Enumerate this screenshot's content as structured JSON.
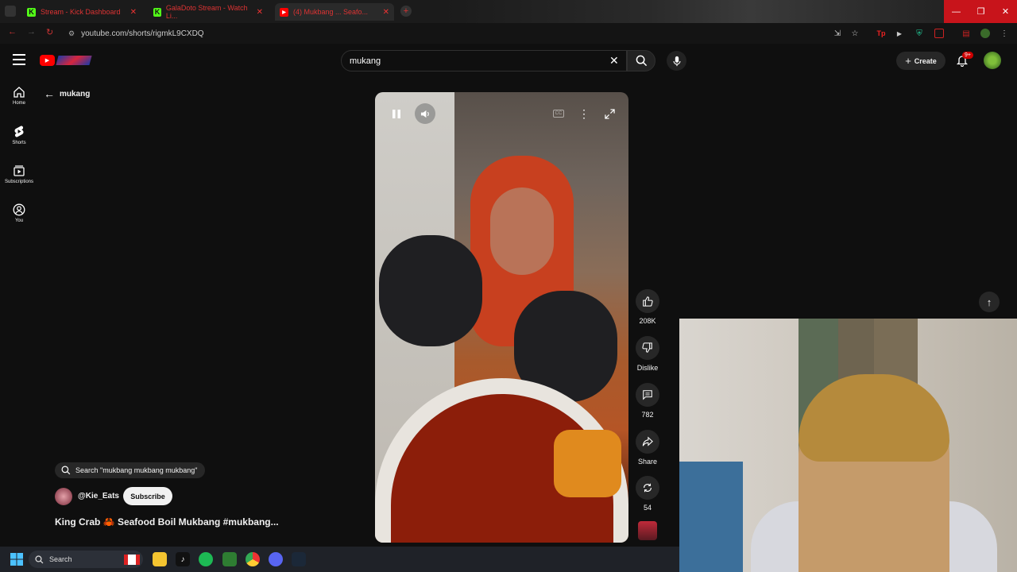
{
  "browser": {
    "tabs": [
      {
        "title": "Stream - Kick Dashboard",
        "favicon": "kick-icon"
      },
      {
        "title": "GalaDoto Stream - Watch Li...",
        "favicon": "kick-icon"
      },
      {
        "title": "(4) Mukbang ... Seafo...",
        "favicon": "youtube-icon"
      }
    ],
    "url": "youtube.com/shorts/rigmkL9CXDQ",
    "window_controls": [
      "—",
      "❐",
      "✕"
    ]
  },
  "youtube": {
    "search_value": "mukang",
    "create_label": "Create",
    "notif_badge": "9+",
    "back_label": "mukang",
    "sidebar": [
      {
        "label": "Home",
        "icon": "home-icon"
      },
      {
        "label": "Shorts",
        "icon": "shorts-icon"
      },
      {
        "label": "Subscriptions",
        "icon": "subscriptions-icon"
      },
      {
        "label": "You",
        "icon": "user-icon"
      }
    ],
    "short": {
      "search_chip": "Search \"mukbang mukbang mukbang\"",
      "channel": "@Kie_Eats",
      "subscribe_label": "Subscribe",
      "title": "King Crab 🦀 Seafood Boil Mukbang #mukbang...",
      "actions": [
        {
          "label": "208K",
          "icon": "thumbs-up-icon"
        },
        {
          "label": "Dislike",
          "icon": "thumbs-down-icon"
        },
        {
          "label": "782",
          "icon": "comment-icon"
        },
        {
          "label": "Share",
          "icon": "share-icon"
        },
        {
          "label": "54",
          "icon": "remix-icon"
        }
      ]
    }
  },
  "taskbar": {
    "search_placeholder": "Search"
  },
  "colors": {
    "accent": "#ff0000",
    "bg": "#0f0f0f",
    "taskbar": "#1f2228"
  }
}
